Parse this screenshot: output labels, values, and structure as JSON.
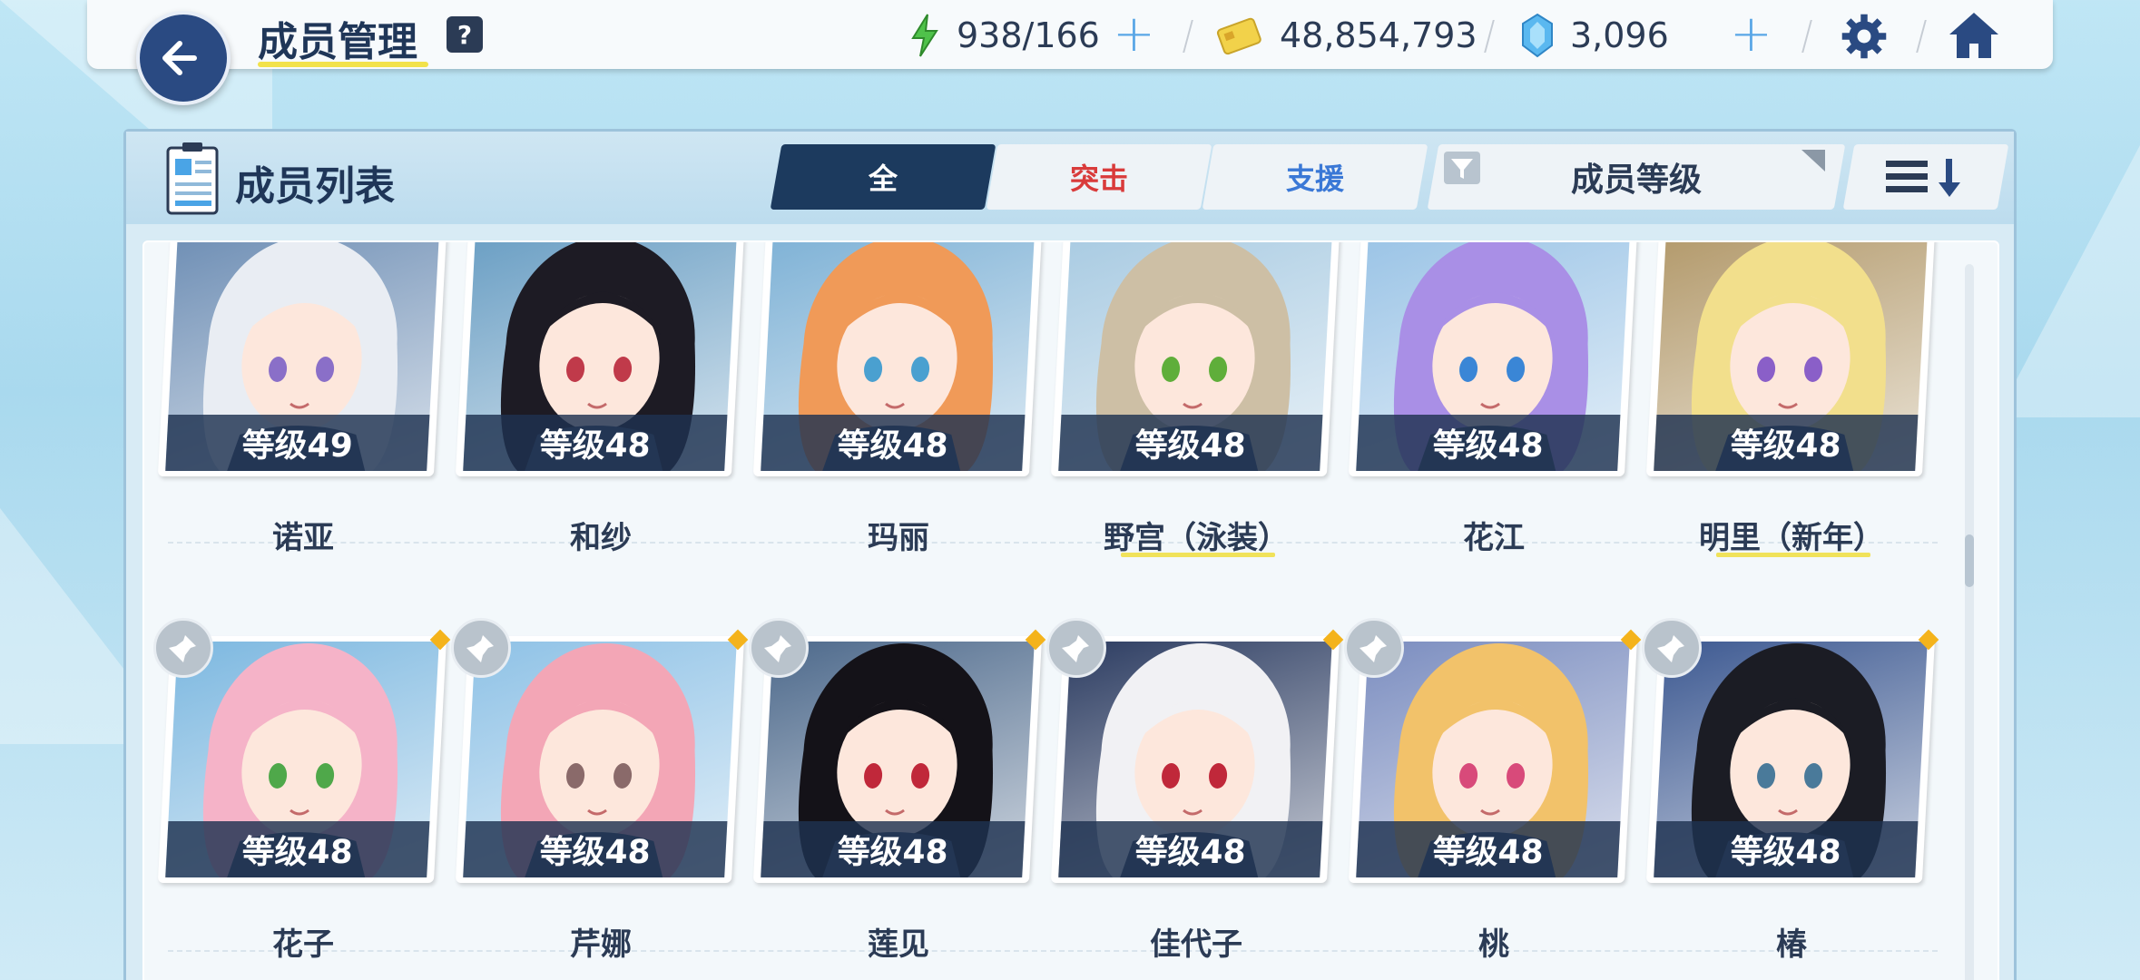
{
  "header": {
    "title": "成员管理",
    "help_label": "?",
    "ap": "938/166",
    "credits": "48,854,793",
    "gems": "3,096"
  },
  "panel": {
    "title": "成员列表",
    "tabs": [
      "全",
      "突击",
      "支援"
    ],
    "sort_label": "成员等级"
  },
  "colors": {
    "accent_dark": "#1c3a5e",
    "strike": "#d93b3b",
    "support": "#3a78d6",
    "underline": "#f2e24a"
  },
  "students": [
    {
      "name": "诺亚",
      "level": "等级49",
      "hair": "#e9edf3",
      "bg": "#6f8fb5",
      "eye": "#8a6fc8"
    },
    {
      "name": "和纱",
      "level": "等级48",
      "hair": "#1d1b24",
      "bg": "#6b9fc4",
      "eye": "#c03a4a"
    },
    {
      "name": "玛丽",
      "level": "等级48",
      "hair": "#f09a58",
      "bg": "#7fb2d6",
      "eye": "#4aa0d0"
    },
    {
      "name": "野宫（泳装）",
      "level": "等级48",
      "hair": "#cdbfa5",
      "bg": "#a9cbe2",
      "eye": "#5fae3a"
    },
    {
      "name": "花江",
      "level": "等级48",
      "hair": "#a98fe6",
      "bg": "#9bc4e6",
      "eye": "#3a86d6"
    },
    {
      "name": "明里（新年）",
      "level": "等级48",
      "hair": "#f2df8c",
      "bg": "#b39a6c",
      "eye": "#8a5fc8"
    },
    {
      "name": "花子",
      "level": "等级48",
      "hair": "#f5b3c8",
      "bg": "#7db8e0",
      "eye": "#4fa84a"
    },
    {
      "name": "芹娜",
      "level": "等级48",
      "hair": "#f3a6b6",
      "bg": "#8fc2e6",
      "eye": "#8a6a6a"
    },
    {
      "name": "莲见",
      "level": "等级48",
      "hair": "#141218",
      "bg": "#4e6a8c",
      "eye": "#c0283a"
    },
    {
      "name": "佳代子",
      "level": "等级48",
      "hair": "#f1f1f4",
      "bg": "#2d3d62",
      "eye": "#c0283a"
    },
    {
      "name": "桃",
      "level": "等级48",
      "hair": "#f2c26a",
      "bg": "#7c8ec0",
      "eye": "#d84a7a"
    },
    {
      "name": "椿",
      "level": "等级48",
      "hair": "#1b1c24",
      "bg": "#3e5a92",
      "eye": "#4a7a9a"
    }
  ]
}
